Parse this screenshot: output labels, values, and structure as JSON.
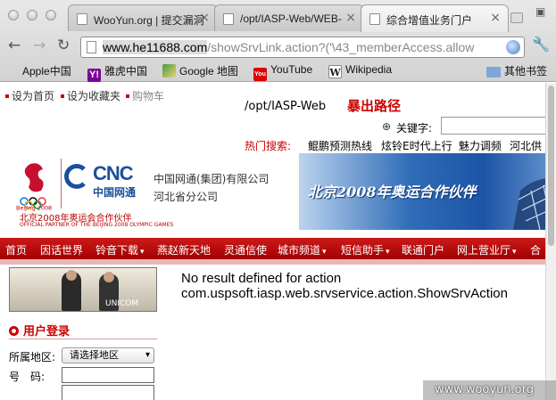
{
  "browser": {
    "tabs": [
      {
        "label": "WooYun.org | 提交漏洞",
        "close": "×"
      },
      {
        "label": "/opt/IASP-Web/WEB-",
        "close": "×"
      },
      {
        "label": "综合增值业务门户",
        "close": "×"
      }
    ],
    "url": {
      "host": "www.he11688.com",
      "path": "/showSrvLink.action?('\\43_memberAccess.allow"
    },
    "bookmarks": [
      {
        "label": "Apple中国",
        "icon": "apple-icon"
      },
      {
        "label": "雅虎中国",
        "icon": "yahoo-icon",
        "glyph": "Y!"
      },
      {
        "label": "Google 地图",
        "icon": "google-maps-icon"
      },
      {
        "label": "YouTube",
        "icon": "youtube-icon",
        "glyph": "You"
      },
      {
        "label": "Wikipedia",
        "icon": "wikipedia-icon",
        "glyph": "W"
      }
    ],
    "other_bookmarks": "其他书签"
  },
  "page": {
    "top_links": [
      "设为首页",
      "设为收藏夹",
      "购物车"
    ],
    "leaked_path": "/opt/IASP-Web",
    "leak_annotation": "暴出路径",
    "keyword_label": "关键字:",
    "hot_search_label": "热门搜索:",
    "hot_search_items": [
      "鲲鹏预测热线",
      "炫铃E时代上行",
      "魅力调频",
      "河北供"
    ],
    "banner": {
      "olympic_small": "Beijing 2008",
      "olympic_caption": "北京2008年奥运会合作伙伴",
      "olympic_caption_en": "OFFICIAL PARTNER OF THE BEIJING 2008 OLYMPIC GAMES",
      "cnc_logo": "CNC",
      "cnc_cn": "中国网通",
      "company_name": "中国网通(集团)有限公司",
      "company_branch": "河北省分公司",
      "slogan": "北京2008年奥运合作伙伴"
    },
    "menu": [
      "首页",
      "因话世界",
      "铃音下载",
      "燕赵新天地",
      "灵通信使",
      "城市频道",
      "短信助手",
      "联通门户",
      "网上营业厅",
      "合"
    ],
    "promo_brand": "UNICOM",
    "error_line1": "No result defined for action",
    "error_line2": "com.uspsoft.iasp.web.srvservice.action.ShowSrvAction",
    "login": {
      "title": "用户登录",
      "region_label": "所属地区:",
      "region_value": "请选择地区",
      "number_label": "号　码:"
    }
  },
  "watermark": "www.wooyun.org"
}
